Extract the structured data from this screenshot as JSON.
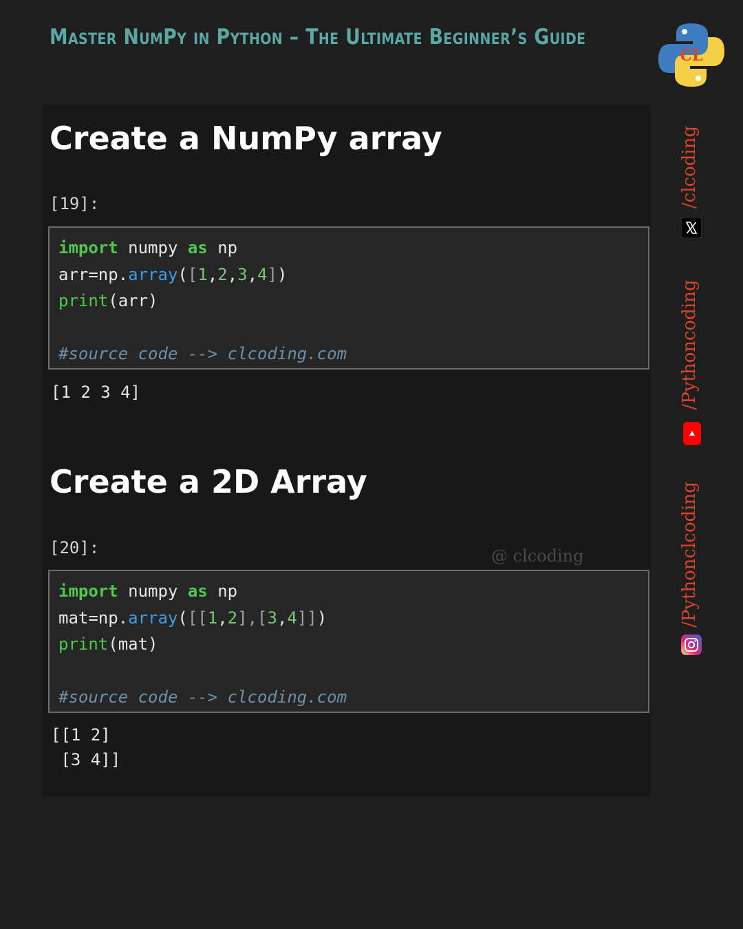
{
  "banner": {
    "title": "Master NumPy in Python – The Ultimate Beginner’s Guide"
  },
  "logo": {
    "icon": "python-logo-icon",
    "letters": "CL"
  },
  "sections": [
    {
      "heading": "Create a NumPy array",
      "prompt": "[19]:",
      "code": {
        "l1_kw1": "import",
        "l1_mod": " numpy ",
        "l1_kw2": "as",
        "l1_alias": " np",
        "l2_var": "arr=np.",
        "l2_fn": "array",
        "l2_open": "(",
        "l2_lb": "[",
        "l2_n1": "1",
        "l2_c1": ",",
        "l2_n2": "2",
        "l2_c2": ",",
        "l2_n3": "3",
        "l2_c3": ",",
        "l2_n4": "4",
        "l2_rb": "]",
        "l2_close": ")",
        "l3_fn": "print",
        "l3_arg": "(arr)",
        "comment": "#source code --> clcoding.com"
      },
      "output": "[1 2 3 4]"
    },
    {
      "heading": "Create a 2D Array",
      "prompt": "[20]:",
      "code": {
        "l1_kw1": "import",
        "l1_mod": " numpy ",
        "l1_kw2": "as",
        "l1_alias": " np",
        "l2_var": "mat=np.",
        "l2_fn": "array",
        "l2_open": "(",
        "l2_lb": "[[",
        "l2_n1": "1",
        "l2_c1": ",",
        "l2_n2": "2",
        "l2_mid": "],[",
        "l2_n3": "3",
        "l2_c3": ",",
        "l2_n4": "4",
        "l2_rb": "]]",
        "l2_close": ")",
        "l3_fn": "print",
        "l3_arg": "(mat)",
        "comment": "#source code --> clcoding.com"
      },
      "output": "[[1 2]\n [3 4]]"
    }
  ],
  "watermark": "@ clcoding",
  "social": {
    "x_handle": "/clcoding",
    "youtube_handle": "/Pythoncoding",
    "instagram_handle": "/Pythonclcoding",
    "colors": {
      "handle": "#d9442a",
      "youtube": "#ff0000"
    }
  }
}
